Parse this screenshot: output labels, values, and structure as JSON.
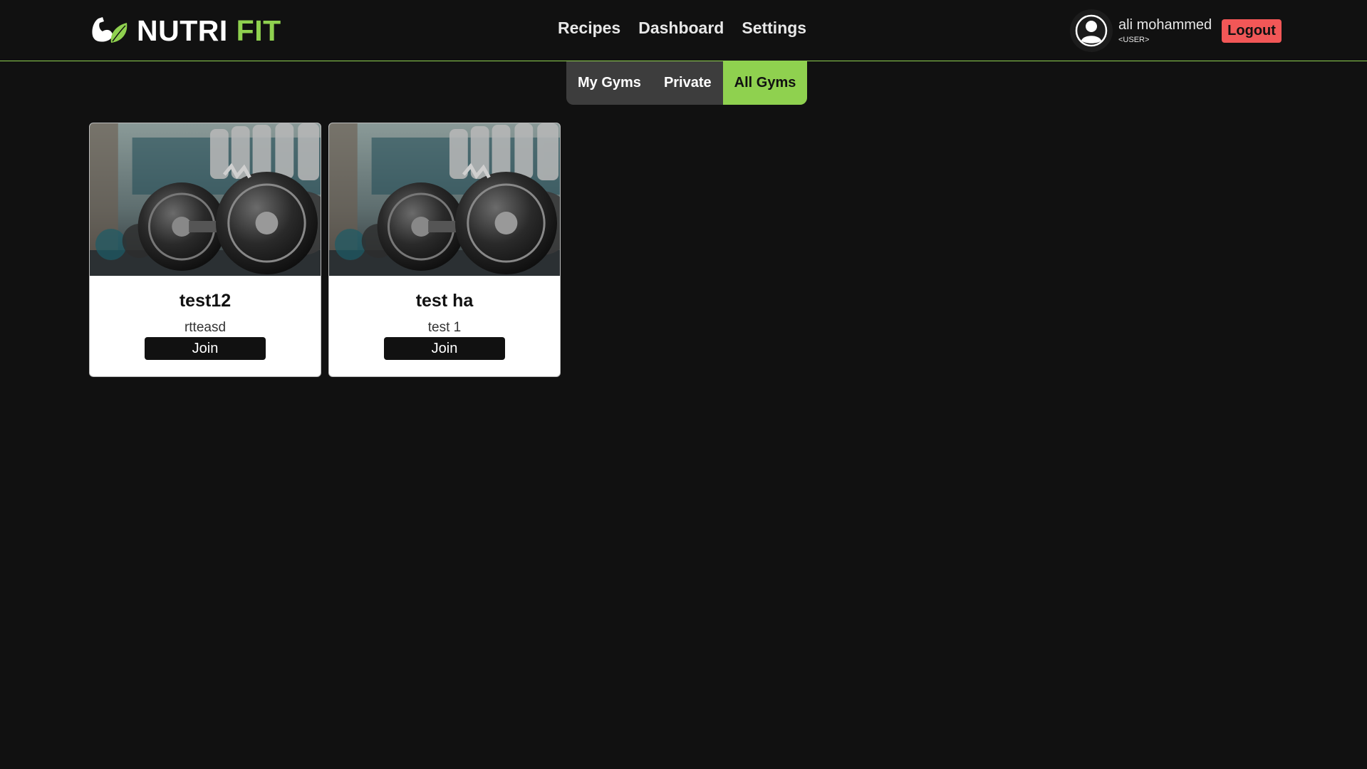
{
  "brand": {
    "part1": "NUTRI",
    "part2": "FIT",
    "accent": "#8fd14f",
    "logo_icon": "flexed-arm-leaf-icon"
  },
  "nav": {
    "items": [
      "Recipes",
      "Dashboard",
      "Settings"
    ]
  },
  "user": {
    "name": "ali mohammed",
    "role": "<USER>",
    "avatar_icon": "user-avatar-icon"
  },
  "logout": {
    "label": "Logout",
    "color": "#f25757"
  },
  "tabs": {
    "items": [
      "My Gyms",
      "Private",
      "All Gyms"
    ],
    "active": "All Gyms"
  },
  "gyms": [
    {
      "title": "test12",
      "description": "rtteasd",
      "action": "Join",
      "image": "dumbbells-photo"
    },
    {
      "title": "test ha",
      "description": "test 1",
      "action": "Join",
      "image": "dumbbells-photo"
    }
  ],
  "colors": {
    "background": "#111111",
    "accent": "#8fd14f",
    "danger": "#f25757"
  }
}
